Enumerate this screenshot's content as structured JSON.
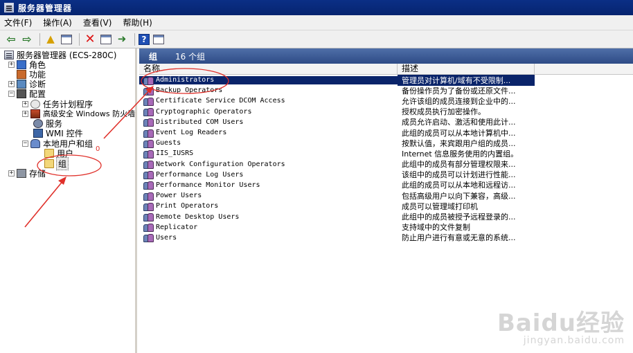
{
  "window": {
    "title": "服务器管理器"
  },
  "menu": [
    {
      "label": "文件(F)"
    },
    {
      "label": "操作(A)"
    },
    {
      "label": "查看(V)"
    },
    {
      "label": "帮助(H)"
    }
  ],
  "tree": {
    "root": "服务器管理器 (ECS-280C)",
    "roles": "角色",
    "features": "功能",
    "diagnostics": "诊断",
    "configuration": "配置",
    "task_scheduler": "任务计划程序",
    "firewall": "高级安全 Windows 防火墙",
    "services": "服务",
    "wmi": "WMI 控件",
    "local_users_groups": "本地用户和组",
    "users": "用户",
    "groups": "组",
    "storage": "存储",
    "expander_plus": "+",
    "expander_minus": "−"
  },
  "header": {
    "title": "组",
    "count": "16 个组"
  },
  "columns": {
    "name": "名称",
    "description": "描述"
  },
  "groups": [
    {
      "name": "Administrators",
      "description": "管理员对计算机/域有不受限制..."
    },
    {
      "name": "Backup Operators",
      "description": "备份操作员为了备份或还原文件..."
    },
    {
      "name": "Certificate Service DCOM Access",
      "description": "允许该组的成员连接到企业中的..."
    },
    {
      "name": "Cryptographic Operators",
      "description": "授权成员执行加密操作。"
    },
    {
      "name": "Distributed COM Users",
      "description": "成员允许启动、激活和使用此计..."
    },
    {
      "name": "Event Log Readers",
      "description": "此组的成员可以从本地计算机中..."
    },
    {
      "name": "Guests",
      "description": "按默认值，来宾跟用户组的成员..."
    },
    {
      "name": "IIS_IUSRS",
      "description": "Internet 信息服务使用的内置组。"
    },
    {
      "name": "Network Configuration Operators",
      "description": "此组中的成员有部分管理权限来..."
    },
    {
      "name": "Performance Log Users",
      "description": "该组中的成员可以计划进行性能..."
    },
    {
      "name": "Performance Monitor Users",
      "description": "此组的成员可以从本地和远程访..."
    },
    {
      "name": "Power Users",
      "description": "包括高级用户以向下兼容，高级..."
    },
    {
      "name": "Print Operators",
      "description": "成员可以管理域打印机"
    },
    {
      "name": "Remote Desktop Users",
      "description": "此组中的成员被授予远程登录的..."
    },
    {
      "name": "Replicator",
      "description": "支持域中的文件复制"
    },
    {
      "name": "Users",
      "description": "防止用户进行有意或无意的系统..."
    }
  ],
  "annotation": {
    "label": "0"
  },
  "watermark": {
    "logo": "Baidu经验",
    "url": "jingyan.baidu.com"
  },
  "colors": {
    "titlebar": "#0b2f86",
    "header": "#3a5a96",
    "selection": "#0a246a",
    "annotation": "#e0302a"
  },
  "icons": [
    "back-arrow-icon",
    "forward-arrow-icon",
    "up-folder-icon",
    "show-tree-icon",
    "delete-icon",
    "properties-icon",
    "export-icon",
    "help-icon",
    "console-icon"
  ]
}
